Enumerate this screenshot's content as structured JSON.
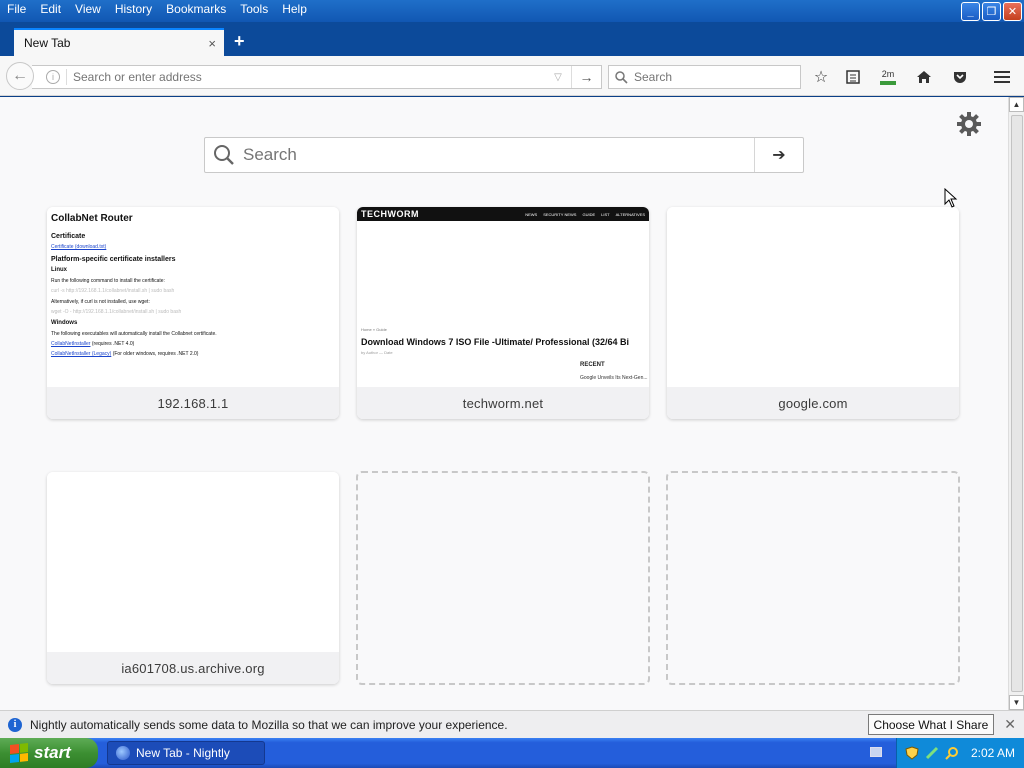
{
  "menubar": {
    "items": [
      "File",
      "Edit",
      "View",
      "History",
      "Bookmarks",
      "Tools",
      "Help"
    ]
  },
  "tab": {
    "title": "New Tab",
    "close": "×",
    "new_tab": "+"
  },
  "navbar": {
    "url_placeholder": "Search or enter address",
    "search_placeholder": "Search",
    "download_label": "2m"
  },
  "content": {
    "search_placeholder": "Search",
    "tiles": [
      {
        "label": "192.168.1.1"
      },
      {
        "label": "techworm.net"
      },
      {
        "label": "google.com"
      },
      {
        "label": "ia601708.us.archive.org"
      }
    ],
    "router_thumb": {
      "title": "CollabNet Router",
      "certificate_heading": "Certificate",
      "certificate_link": "Certificate (download.txt)",
      "platform_heading": "Platform-specific certificate installers",
      "linux_heading": "Linux",
      "linux_text": "Run the following command to install the certificate:",
      "linux_alt": "Alternatively, if curl is not installed, use wget:",
      "windows_heading": "Windows",
      "windows_text": "The following executables will automatically install the Collabnet certificate.",
      "windows_link1": "CollabNetInstaller",
      "windows_link1_note": "(requires .NET 4.0)",
      "windows_link2": "CollabNetInstaller (Legacy)",
      "windows_link2_note": "(For older windows, requires .NET 2.0)"
    },
    "techworm_thumb": {
      "logo": "TECHWORM",
      "nav": [
        "NEWS",
        "SECURITY NEWS",
        "GUIDE",
        "LIST",
        "ALTERNATIVES"
      ],
      "title": "Download Windows 7 ISO File -Ultimate/ Professional (32/64 Bi",
      "recent": "RECENT",
      "recent_item": "Google Unveils Its Next-Gen..."
    }
  },
  "notification": {
    "message": "Nightly automatically sends some data to Mozilla so that we can improve your experience.",
    "button": "Choose What I Share"
  },
  "taskbar": {
    "start": "start",
    "task_label": "New Tab - Nightly",
    "clock": "2:02 AM"
  }
}
